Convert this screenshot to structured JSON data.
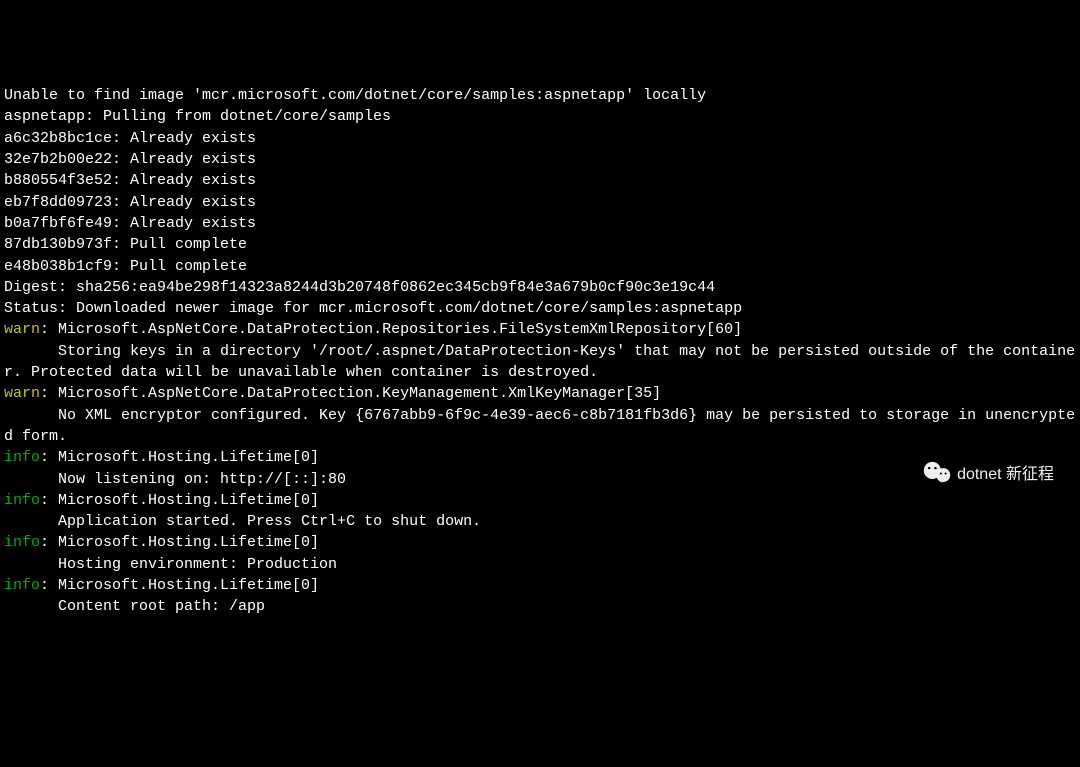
{
  "lines": [
    {
      "segments": [
        {
          "text": "Unable to find image 'mcr.microsoft.com/dotnet/core/samples:aspnetapp' locally"
        }
      ]
    },
    {
      "segments": [
        {
          "text": "aspnetapp: Pulling from dotnet/core/samples"
        }
      ]
    },
    {
      "segments": [
        {
          "text": "a6c32b8bc1ce: Already exists"
        }
      ]
    },
    {
      "segments": [
        {
          "text": "32e7b2b00e22: Already exists"
        }
      ]
    },
    {
      "segments": [
        {
          "text": "b880554f3e52: Already exists"
        }
      ]
    },
    {
      "segments": [
        {
          "text": "eb7f8dd09723: Already exists"
        }
      ]
    },
    {
      "segments": [
        {
          "text": "b0a7fbf6fe49: Already exists"
        }
      ]
    },
    {
      "segments": [
        {
          "text": "87db130b973f: Pull complete"
        }
      ]
    },
    {
      "segments": [
        {
          "text": "e48b038b1cf9: Pull complete"
        }
      ]
    },
    {
      "segments": [
        {
          "text": "Digest: sha256:ea94be298f14323a8244d3b20748f0862ec345cb9f84e3a679b0cf90c3e19c44"
        }
      ]
    },
    {
      "segments": [
        {
          "text": "Status: Downloaded newer image for mcr.microsoft.com/dotnet/core/samples:aspnetapp"
        }
      ]
    },
    {
      "segments": [
        {
          "text": "warn",
          "cls": "lvl-warn"
        },
        {
          "text": ": Microsoft.AspNetCore.DataProtection.Repositories.FileSystemXmlRepository[60]"
        }
      ]
    },
    {
      "segments": [
        {
          "text": "      Storing keys in a directory '/root/.aspnet/DataProtection-Keys' that may not be persisted outside of the container. Protected data will be unavailable when container is destroyed."
        }
      ]
    },
    {
      "segments": [
        {
          "text": "warn",
          "cls": "lvl-warn"
        },
        {
          "text": ": Microsoft.AspNetCore.DataProtection.KeyManagement.XmlKeyManager[35]"
        }
      ]
    },
    {
      "segments": [
        {
          "text": "      No XML encryptor configured. Key {6767abb9-6f9c-4e39-aec6-c8b7181fb3d6} may be persisted to storage in unencrypted form."
        }
      ]
    },
    {
      "segments": [
        {
          "text": "info",
          "cls": "lvl-info"
        },
        {
          "text": ": Microsoft.Hosting.Lifetime[0]"
        }
      ]
    },
    {
      "segments": [
        {
          "text": "      Now listening on: http://[::]:80"
        }
      ]
    },
    {
      "segments": [
        {
          "text": "info",
          "cls": "lvl-info"
        },
        {
          "text": ": Microsoft.Hosting.Lifetime[0]"
        }
      ]
    },
    {
      "segments": [
        {
          "text": "      Application started. Press Ctrl+C to shut down."
        }
      ]
    },
    {
      "segments": [
        {
          "text": "info",
          "cls": "lvl-info"
        },
        {
          "text": ": Microsoft.Hosting.Lifetime[0]"
        }
      ]
    },
    {
      "segments": [
        {
          "text": "      Hosting environment: Production"
        }
      ]
    },
    {
      "segments": [
        {
          "text": "info",
          "cls": "lvl-info"
        },
        {
          "text": ": Microsoft.Hosting.Lifetime[0]"
        }
      ]
    },
    {
      "segments": [
        {
          "text": "      Content root path: /app"
        }
      ]
    }
  ],
  "watermark": {
    "text": "dotnet 新征程"
  }
}
